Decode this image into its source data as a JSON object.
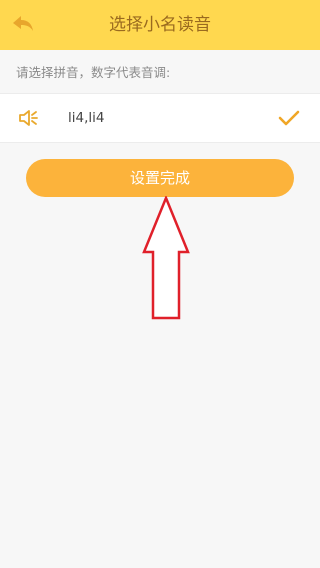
{
  "header": {
    "title": "选择小名读音",
    "back_icon": "back-arrow-icon"
  },
  "hint": "请选择拼音，数字代表音调:",
  "option": {
    "pinyin": "li4,li4",
    "speaker_icon": "speaker-icon",
    "check_icon": "checkmark-icon",
    "selected": true
  },
  "done_button": {
    "label": "设置完成"
  },
  "annotation": {
    "icon": "red-up-arrow-outline"
  },
  "colors": {
    "header_bg": "#ffd84f",
    "title_text": "#9a6a1f",
    "button_bg": "#fcb33b",
    "accent_icon": "#e9a92e",
    "arrow_stroke": "#e0202a"
  }
}
